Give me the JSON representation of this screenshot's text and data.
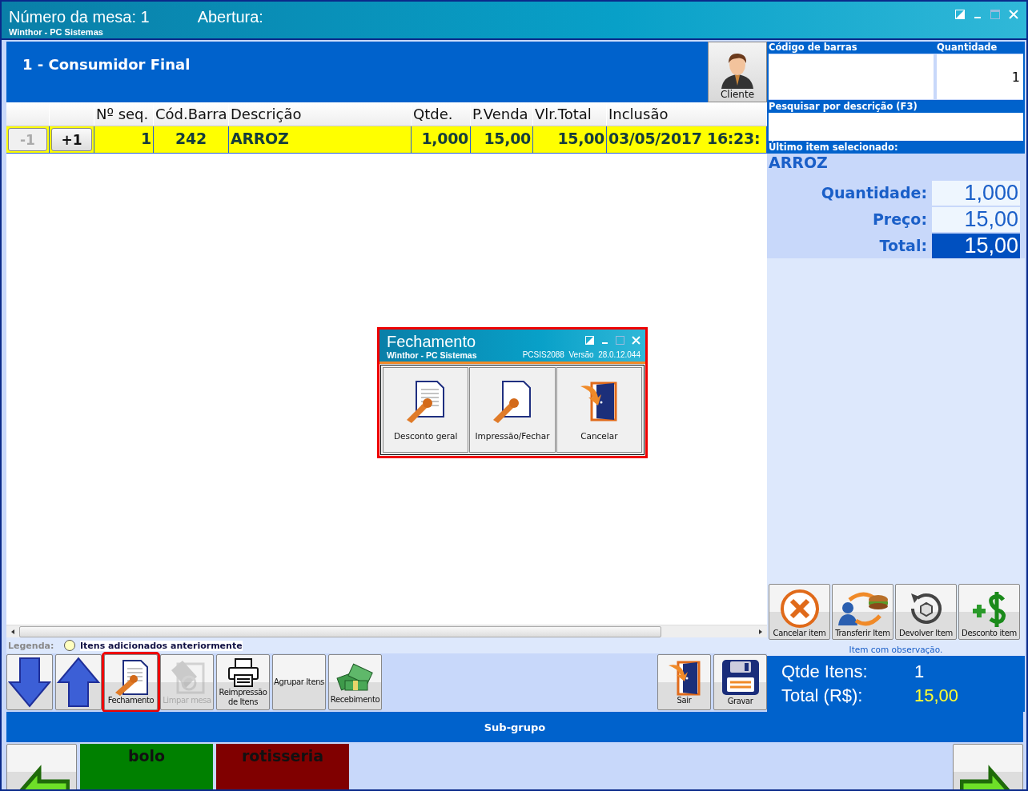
{
  "window": {
    "title": "Número da mesa: 1",
    "opening_label": "Abertura:",
    "subtitle": "Winthor - PC Sistemas"
  },
  "customer": {
    "name": "1 - Consumidor Final",
    "button": "Cliente"
  },
  "table": {
    "columns": [
      "Nº seq.",
      "Cód.Barra",
      "Descrição",
      "Qtde.",
      "P.Venda",
      "Vlr.Total",
      "Inclusão"
    ],
    "rows": [
      {
        "minus": "-1",
        "minus_disabled": true,
        "plus": "+1",
        "previously_added": true,
        "cells": [
          "1",
          "242",
          "ARROZ",
          "1,000",
          "15,00",
          "15,00",
          "03/05/2017 16:23:"
        ]
      }
    ]
  },
  "legend": {
    "label": "Legenda:",
    "item": "Itens adicionados anteriormente"
  },
  "toolbar": [
    {
      "kind": "down",
      "disabled": false,
      "annotated": false
    },
    {
      "kind": "up",
      "disabled": false,
      "annotated": false
    },
    {
      "kind": "document-pen",
      "label": "Fechamento",
      "disabled": false,
      "annotated": true
    },
    {
      "kind": "eraser",
      "label": "Limpar mesa",
      "disabled": true,
      "annotated": false
    },
    {
      "kind": "printer",
      "label": "Reimpressão de Itens",
      "disabled": false,
      "annotated": false
    },
    {
      "kind": "text",
      "label": "Agrupar Itens",
      "disabled": false,
      "annotated": false
    },
    {
      "kind": "money",
      "label": "Recebimento",
      "disabled": false,
      "annotated": false
    }
  ],
  "toolbar_right": [
    {
      "kind": "exit",
      "label": "Sair"
    },
    {
      "kind": "save",
      "label": "Gravar"
    }
  ],
  "entry": {
    "barcode_label": "Código de barras",
    "quantity_label": "Quantidade",
    "quantity_value": "1",
    "search_label": "Pesquisar por descrição (F3)"
  },
  "last_item": {
    "label": "Último item selecionado:",
    "name": "ARROZ",
    "details": [
      {
        "label": "Quantidade:",
        "value": "1,000",
        "highlighted": false
      },
      {
        "label": "Preço:",
        "value": "15,00",
        "highlighted": false
      },
      {
        "label": "Total:",
        "value": "15,00",
        "highlighted": true
      }
    ]
  },
  "item_buttons": [
    {
      "kind": "cancel",
      "label": "Cancelar item"
    },
    {
      "kind": "transfer",
      "label": "Transferir Item"
    },
    {
      "kind": "return",
      "label": "Devolver Item"
    },
    {
      "kind": "discount",
      "label": "Desconto item"
    }
  ],
  "note": "Item com observação.",
  "totals": [
    {
      "label": "Qtde Itens:",
      "value": "1"
    },
    {
      "label": "Total (R$):",
      "value": "15,00"
    }
  ],
  "subgroup": {
    "title": "Sub-grupo",
    "categories": [
      {
        "label": "bolo",
        "color": "#008000"
      },
      {
        "label": "rotisseria",
        "color": "#800000"
      }
    ]
  },
  "dialog": {
    "title": "Fechamento",
    "subtitle": "Winthor - PC Sistemas",
    "version": "PCSIS2088  Versão  28.0.12.044",
    "annotated": true,
    "buttons": [
      {
        "kind": "document-pen",
        "label": "Desconto geral"
      },
      {
        "kind": "blank-pen",
        "label": "Impressão/Fechar"
      },
      {
        "kind": "exit",
        "label": "Cancelar"
      }
    ]
  }
}
